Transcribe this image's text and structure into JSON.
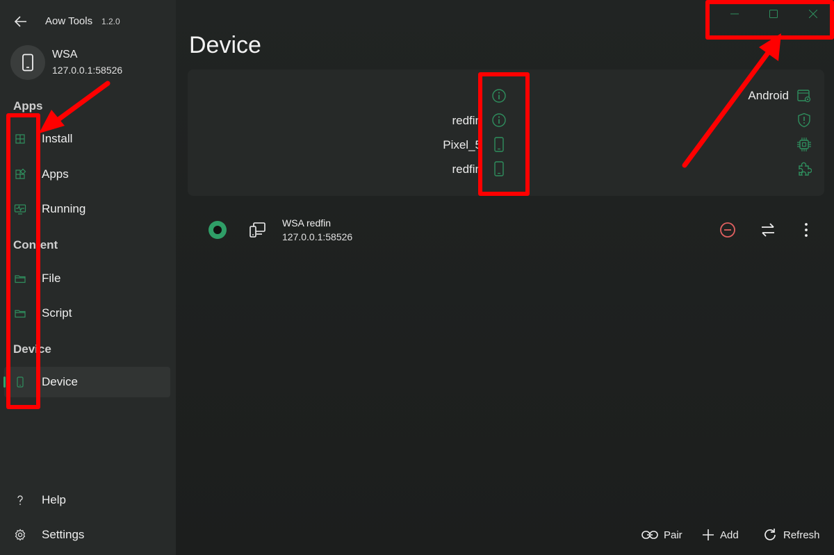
{
  "app": {
    "title": "Aow Tools",
    "version": "1.2.0"
  },
  "device_header": {
    "name": "WSA",
    "address": "127.0.0.1:58526"
  },
  "sections": {
    "apps": "Apps",
    "content": "Content",
    "device": "Device"
  },
  "nav": {
    "install": {
      "label": "Install",
      "icon": "install-grid-icon"
    },
    "apps": {
      "label": "Apps",
      "icon": "apps-grid-icon"
    },
    "running": {
      "label": "Running",
      "icon": "monitor-pulse-icon"
    },
    "file": {
      "label": "File",
      "icon": "folder-icon"
    },
    "script": {
      "label": "Script",
      "icon": "folder-icon"
    },
    "device": {
      "label": "Device",
      "icon": "phone-icon"
    },
    "help": {
      "label": "Help",
      "icon": "question-icon"
    },
    "settings": {
      "label": "Settings",
      "icon": "gear-icon"
    }
  },
  "page": {
    "title": "Device"
  },
  "info_card": {
    "left_values": [
      "",
      "redfin",
      "Pixel_5",
      "redfin"
    ],
    "right_values": [
      "Android",
      "",
      "",
      ""
    ]
  },
  "device_row": {
    "title": "WSA  redfin",
    "address": "127.0.0.1:58526"
  },
  "commands": {
    "pair": "Pair",
    "add": "Add",
    "refresh": "Refresh"
  },
  "colors": {
    "accent": "#2fa36b",
    "danger": "#e06060",
    "annotation": "#ff0000",
    "background": "#1f2221"
  }
}
